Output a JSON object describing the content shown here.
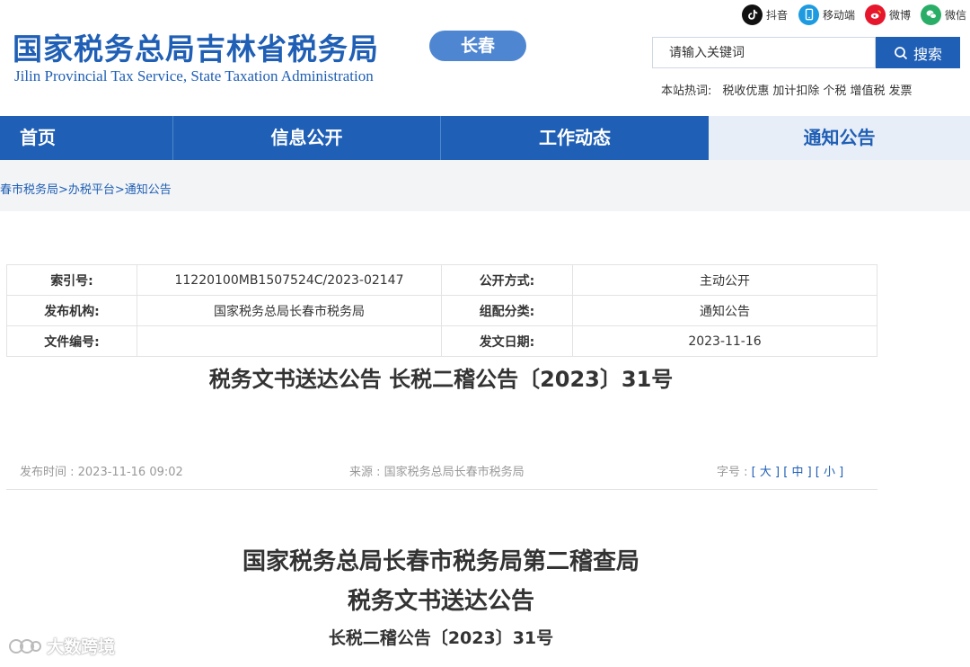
{
  "header": {
    "logo_cn": "国家税务总局吉林省税务局",
    "logo_en": "Jilin Provincial Tax Service, State Taxation Administration",
    "city_badge": "长春",
    "social": [
      {
        "label": "抖音",
        "icon": "douyin-icon",
        "color": "#111111"
      },
      {
        "label": "移动端",
        "icon": "mobile-icon",
        "color": "#1e9be0"
      },
      {
        "label": "微博",
        "icon": "weibo-icon",
        "color": "#e6162d"
      },
      {
        "label": "微信",
        "icon": "wechat-icon",
        "color": "#2aae67"
      }
    ],
    "search": {
      "placeholder": "请输入关键词",
      "button": "搜索"
    },
    "hotwords": {
      "label": "本站热词:",
      "items": [
        "税收优惠",
        "加计扣除",
        "个税",
        "增值税",
        "发票"
      ]
    }
  },
  "nav": {
    "items": [
      "首页",
      "信息公开",
      "工作动态",
      "通知公告"
    ],
    "active_index": 3
  },
  "breadcrumb": "春市税务局>办税平台>通知公告",
  "meta": {
    "index_label": "索引号:",
    "index_value": "11220100MB1507524C/2023-02147",
    "mode_label": "公开方式:",
    "mode_value": "主动公开",
    "org_label": "发布机构:",
    "org_value": "国家税务总局长春市税务局",
    "category_label": "组配分类:",
    "category_value": "通知公告",
    "docno_label": "文件编号:",
    "docno_value": "",
    "date_label": "发文日期:",
    "date_value": "2023-11-16"
  },
  "doc_title": "税务文书送达公告 长税二稽公告〔2023〕31号",
  "info": {
    "publish_time": "发布时间 : 2023-11-16 09:02",
    "source": "来源 : 国家税务总局长春市税务局",
    "font_size_label": "字号 :",
    "font_sizes": [
      "大",
      "中",
      "小"
    ]
  },
  "body": {
    "title_line1": "国家税务总局长春市税务局第二稽查局",
    "title_line2": "税务文书送达公告",
    "doc_number": "长税二稽公告〔2023〕31号"
  },
  "watermark": "大数跨境",
  "colors": {
    "brand": "#1f5fb5",
    "badge": "#4f86d2",
    "nav_active_bg": "#e8eef7"
  }
}
